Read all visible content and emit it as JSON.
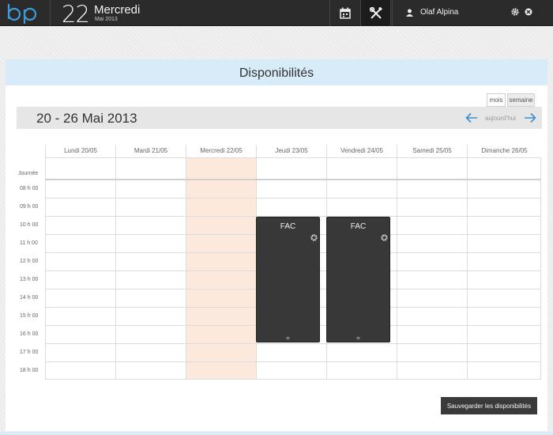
{
  "topbar": {
    "logo_text": "bp",
    "day_number": "22",
    "weekday": "Mercredi",
    "month_year": "Mai 2013",
    "calendar_icon": "calendar-icon",
    "tools_icon": "tools-icon",
    "user_name": "Olaf Alpina"
  },
  "panel": {
    "title": "Disponibilités",
    "view_month_label": "mois",
    "view_week_label": "semaine",
    "range_title": "20 - 26 Mai 2013",
    "today_label": "aujourd'hui"
  },
  "calendar": {
    "days": [
      "Lundi 20/05",
      "Mardi 21/05",
      "Mercredi 22/05",
      "Jeudi 23/05",
      "Vendredi 24/05",
      "Samedi 25/05",
      "Dimanche 26/05"
    ],
    "today_index": 2,
    "journee_label": "Journée",
    "hours": [
      "08 h 00",
      "09 h 00",
      "10 h 00",
      "11 h 00",
      "12 h 00",
      "13 h 00",
      "14 h 00",
      "15 h 00",
      "16 h 00",
      "17 h 00",
      "18 h 00"
    ],
    "events": [
      {
        "title": "FAC",
        "day_index": 3,
        "start_hour": "10 h 00",
        "end_hour": "17 h 00"
      },
      {
        "title": "FAC",
        "day_index": 4,
        "start_hour": "10 h 00",
        "end_hour": "17 h 00"
      }
    ]
  },
  "save_button_label": "Sauvegarder les disponibilités",
  "colors": {
    "topbar": "#2b2b2b",
    "header_band": "#d7ebf8",
    "today_column": "#fde9dc",
    "event": "#383838",
    "accent": "#3d8fcf"
  }
}
